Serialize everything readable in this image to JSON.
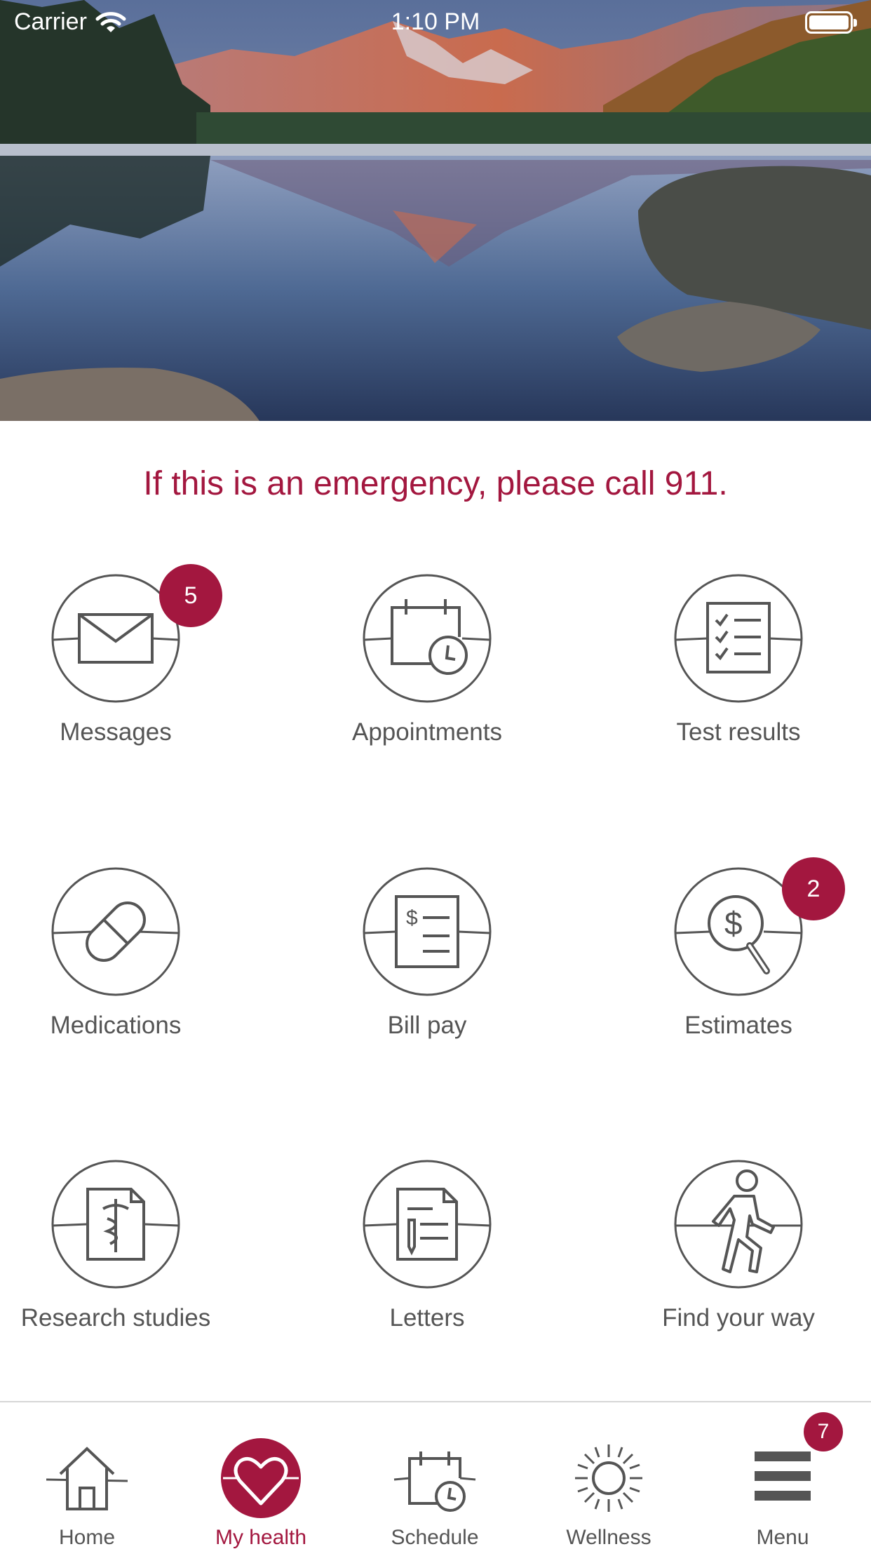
{
  "status_bar": {
    "carrier": "Carrier",
    "time": "1:10 PM"
  },
  "emergency_notice": "If this is an emergency, please call 911.",
  "colors": {
    "accent": "#a3173f",
    "icon_gray": "#555555",
    "divider": "#d6d6d6"
  },
  "tiles": [
    {
      "label": "Messages",
      "icon": "envelope-icon",
      "badge": "5"
    },
    {
      "label": "Appointments",
      "icon": "calendar-clock-icon"
    },
    {
      "label": "Test results",
      "icon": "checklist-icon"
    },
    {
      "label": "Medications",
      "icon": "pill-capsule-icon"
    },
    {
      "label": "Bill pay",
      "icon": "bill-document-icon"
    },
    {
      "label": "Estimates",
      "icon": "dollar-magnifier-icon",
      "badge": "2"
    },
    {
      "label": "Research studies",
      "icon": "caduceus-document-icon"
    },
    {
      "label": "Letters",
      "icon": "letter-document-icon"
    },
    {
      "label": "Find your way",
      "icon": "walking-person-icon"
    }
  ],
  "tab_bar": {
    "tabs": [
      {
        "label": "Home",
        "icon": "house-icon"
      },
      {
        "label": "My health",
        "icon": "heart-icon",
        "active": true
      },
      {
        "label": "Schedule",
        "icon": "calendar-clock-icon"
      },
      {
        "label": "Wellness",
        "icon": "sun-icon"
      },
      {
        "label": "Menu",
        "icon": "hamburger-menu-icon",
        "badge": "7"
      }
    ]
  }
}
